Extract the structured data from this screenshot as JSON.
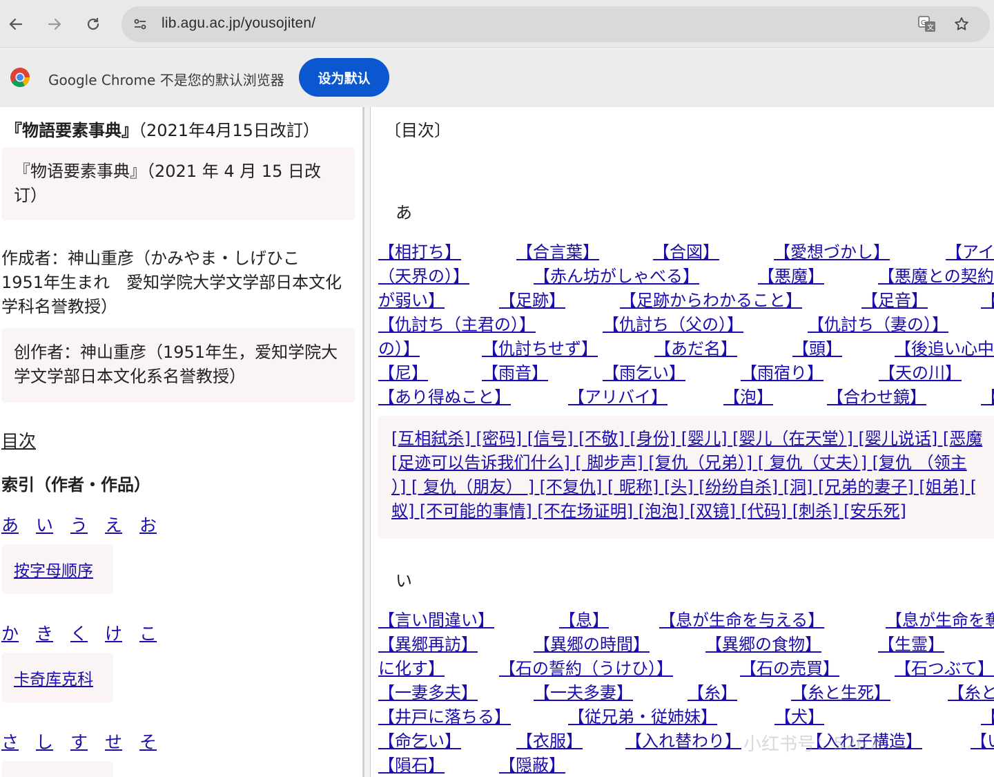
{
  "browser": {
    "url": "lib.agu.ac.jp/yousojiten/",
    "infobar_text": "Google Chrome 不是您的默认浏览器",
    "default_button": "设为默认"
  },
  "left": {
    "title_bold": "『物語要素事典』",
    "title_rest": "（2021年4月15日改訂）",
    "box1": "『物语要素事典』（2021 年 4 月 15 日改订）",
    "author_jp": "作成者：神山重彦（かみやま・しげひこ　1951年生まれ　愛知学院大学文学部日本文化学科名誉教授）",
    "box2": "创作者：神山重彦（1951年生，爱知学院大学文学部日本文化系名誉教授）",
    "toc_link": "目次",
    "index_heading": "索引（作者・作品）",
    "kana_a": [
      "あ",
      "い",
      "う",
      "え",
      "お"
    ],
    "box_a": "按字母顺序",
    "kana_ka": [
      "か",
      "き",
      "く",
      "け",
      "こ"
    ],
    "box_ka": "卡奇库克科",
    "kana_sa": [
      "さ",
      "し",
      "す",
      "せ",
      "そ"
    ]
  },
  "right": {
    "toc_head": "〔目次〕",
    "section_a": "あ",
    "section_i": "い",
    "rows_a": [
      [
        "【相打ち】",
        "【合言葉】",
        "【合図】",
        "【愛想づかし】",
        "【アイ"
      ],
      [
        "（天界の）】",
        "【赤ん坊がしゃべる】",
        "【悪魔】",
        "【悪魔との契約"
      ],
      [
        "が弱い】",
        "【足跡】",
        "【足跡からわかること】",
        "【足音】",
        "【"
      ],
      [
        "【仇討ち（主君の）】",
        "【仇討ち（父の）】",
        "【仇討ち（妻の）】"
      ],
      [
        "の）】",
        "【仇討ちせず】",
        "【あだ名】",
        "【頭】",
        "【後追い心中"
      ],
      [
        "【尼】",
        "【雨音】",
        "【雨乞い】",
        "【雨宿り】",
        "【天の川】"
      ],
      [
        "【あり得ぬこと】",
        "【アリバイ】",
        "【泡】",
        "【合わせ鏡】",
        "【"
      ]
    ],
    "cbox_lines": [
      "[互相弑杀] [密码] [信号] [不敬] [身份] [婴儿] [婴儿（在天堂）] [婴儿说话] [恶魔",
      "[足迹可以告诉我们什么] [ 脚步声] [复仇（兄弟）] [ 复仇（丈夫）] [复仇 （领主",
      "）] [ 复仇（朋友） ] [不复仇] [ 昵称] [头] [纷纷自杀] [洞] [兄弟的妻子] [姐弟] [",
      "蚁] [不可能的事情] [不在场证明] [泡泡] [双镜] [代码] [刺杀] [安乐死]"
    ],
    "rows_i": [
      [
        "【言い間違い】",
        "【息】",
        "【息が生命を与える】",
        "【息が生命を奪"
      ],
      [
        "【異郷再訪】",
        "【異郷の時間】",
        "【異郷の食物】",
        "【生霊】"
      ],
      [
        "に化す】",
        "【石の誓約（うけひ）】",
        "【石の売買】",
        "【石つぶて】"
      ],
      [
        "【一妻多夫】",
        "【一夫多妻】",
        "【糸】",
        "【糸と生死】",
        "【糸と"
      ],
      [
        "【井戸に落ちる】",
        "【従兄弟・従姉妹】",
        "【犬】",
        "【犬に転生】"
      ],
      [
        "【命乞い】",
        "【衣服】",
        "【入れ替わり】",
        "【入れ子構造】",
        "【い"
      ],
      [
        "【隕石】",
        "【隠蔽】"
      ]
    ],
    "watermark": "小红书号：5267"
  }
}
